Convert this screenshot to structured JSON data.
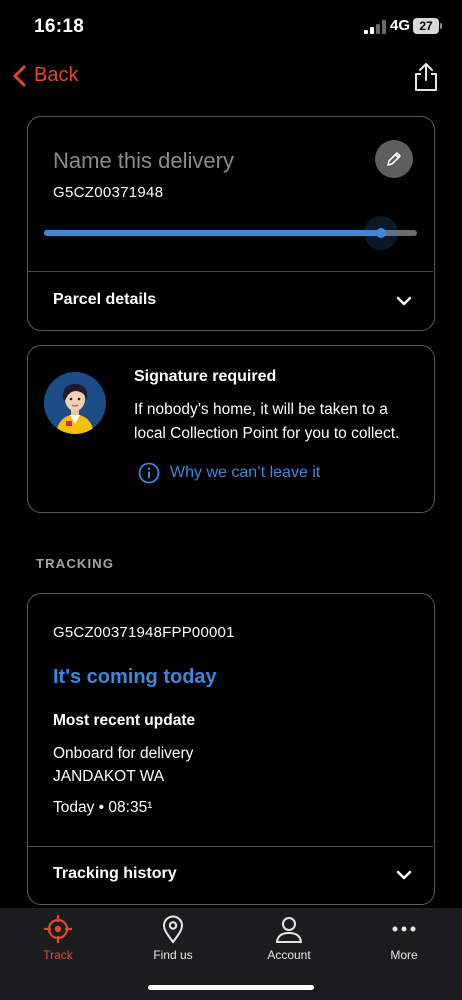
{
  "status_bar": {
    "time": "16:18",
    "network": "4G",
    "battery": "27"
  },
  "nav": {
    "back_label": "Back"
  },
  "delivery": {
    "name_placeholder": "Name this delivery",
    "consignment_id": "G5CZ00371948",
    "progress": 0.9,
    "parcel_details_label": "Parcel details"
  },
  "signature": {
    "title": "Signature required",
    "body": "If nobody’s home, it will be taken to a local Collection Point for you to collect.",
    "why_link": "Why we can’t leave it"
  },
  "tracking": {
    "section_label": "TRACKING",
    "article_id": "G5CZ00371948FPP00001",
    "eta": "It's coming today",
    "recent_heading": "Most recent update",
    "update_status": "Onboard for delivery",
    "update_location": "JANDAKOT WA",
    "update_time": "Today • 08:35¹",
    "history_label": "Tracking history"
  },
  "tabs": [
    {
      "label": "Track",
      "icon": "crosshair-icon",
      "active": true
    },
    {
      "label": "Find us",
      "icon": "location-pin-icon",
      "active": false
    },
    {
      "label": "Account",
      "icon": "user-icon",
      "active": false
    },
    {
      "label": "More",
      "icon": "more-dots-icon",
      "active": false
    }
  ],
  "colors": {
    "accent_red": "#e4472f",
    "accent_blue": "#3d87dc",
    "background": "#000000",
    "tabbar": "#1c1c1e"
  }
}
